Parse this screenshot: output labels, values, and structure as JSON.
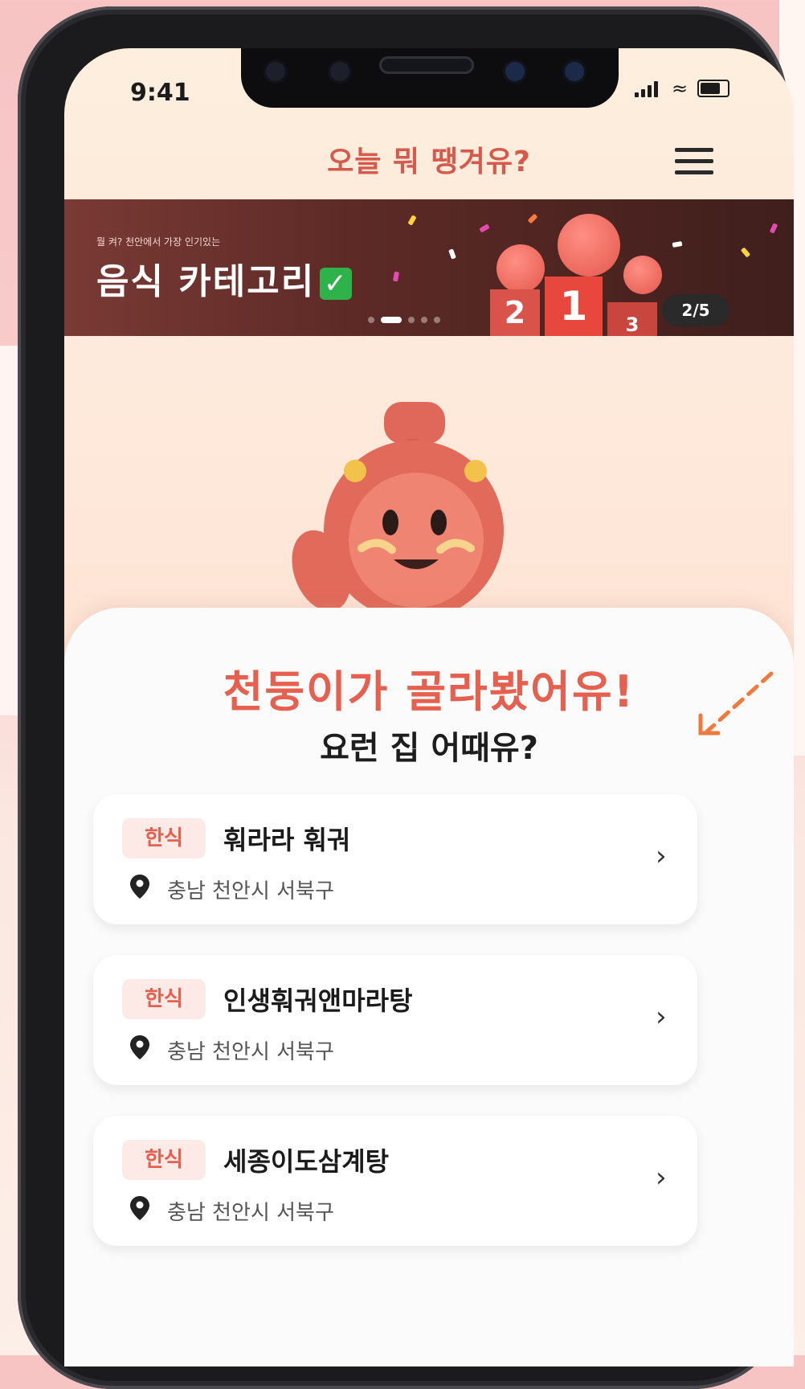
{
  "status_bar": {
    "time": "9:41"
  },
  "header": {
    "app_title": "오늘 뭐 땡겨유?"
  },
  "banner": {
    "subtitle": "뭘 켜? 천안에서 가장 인기있는",
    "title": "음식 카테고리",
    "page_indicator": "2/5",
    "podium_labels": [
      "2",
      "1",
      "3"
    ],
    "slides_total": 5,
    "active_slide": 2
  },
  "recommend": {
    "headline": "천둥이가 골라봤어유!",
    "subheadline": "요런 집 어때유?"
  },
  "restaurants": [
    {
      "category": "한식",
      "name": "훠라라 훠궈",
      "location": "충남 천안시 서북구"
    },
    {
      "category": "한식",
      "name": "인생훠궈앤마라탕",
      "location": "충남 천안시 서북구"
    },
    {
      "category": "한식",
      "name": "세종이도삼계탕",
      "location": "충남 천안시 서북구"
    }
  ],
  "colors": {
    "accent": "#e5604f",
    "badge_bg": "#fdeae7",
    "banner_bg": "#5d2a26"
  },
  "icons": {
    "menu": "hamburger-icon",
    "location": "map-pin-icon",
    "chevron": "chevron-right-icon"
  }
}
